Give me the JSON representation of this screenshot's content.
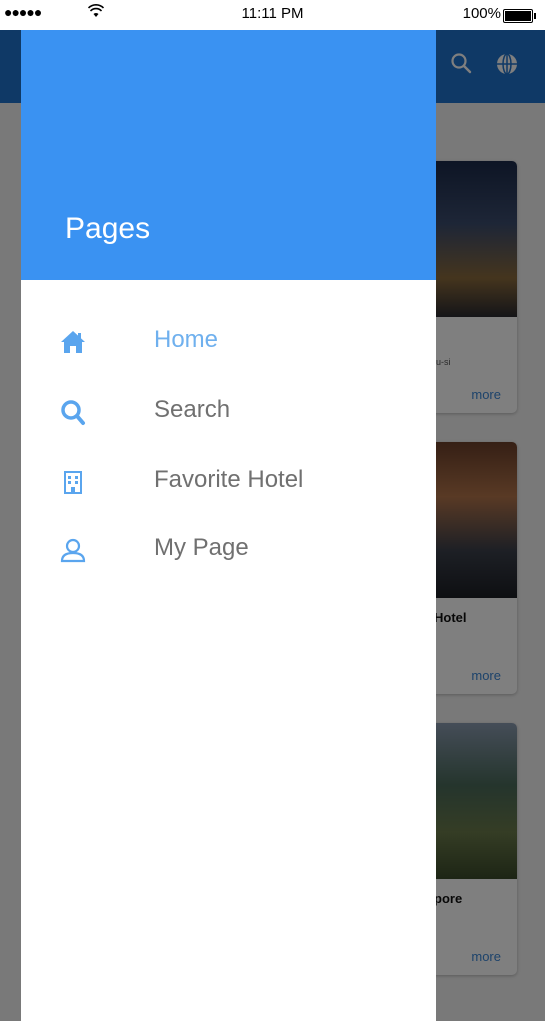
{
  "status_bar": {
    "signal": "●●●●●",
    "wifi": "ᯤ",
    "time": "11:11 PM",
    "battery": "100%"
  },
  "drawer": {
    "title": "Pages",
    "items": [
      {
        "label": "Home",
        "icon": "home-icon",
        "active": true
      },
      {
        "label": "Search",
        "icon": "search-icon",
        "active": false
      },
      {
        "label": "Favorite Hotel",
        "icon": "building-icon",
        "active": false
      },
      {
        "label": "My Page",
        "icon": "user-icon",
        "active": false
      }
    ]
  },
  "background": {
    "cards": [
      {
        "title": "",
        "subtitle": "ju-si",
        "more": "more"
      },
      {
        "title": "Hotel",
        "subtitle": "",
        "more": "more"
      },
      {
        "title": "pore",
        "subtitle": "",
        "more": "more"
      }
    ]
  },
  "colors": {
    "drawer_header": "#3a92f2",
    "active_item": "#6fb0ee",
    "icon": "#5aa5ee",
    "app_header": "#1e73cc"
  }
}
